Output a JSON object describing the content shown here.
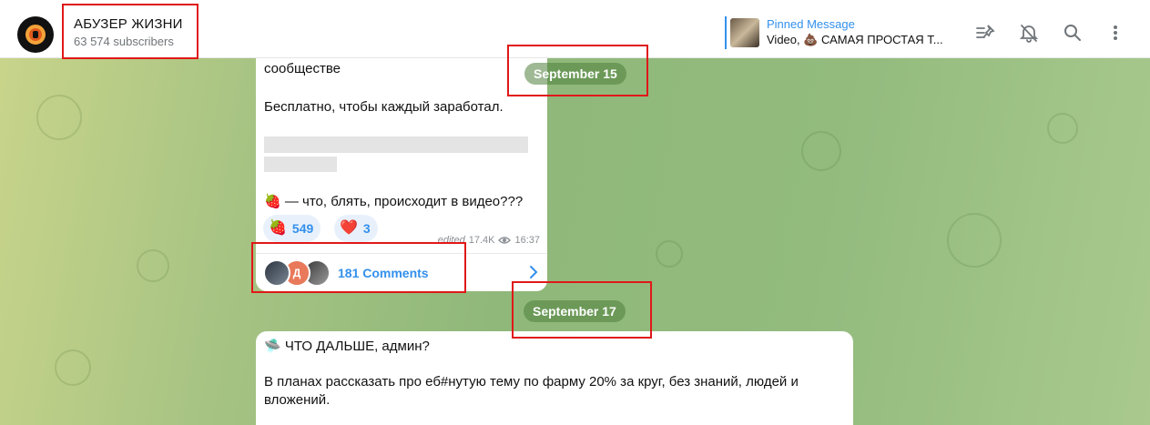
{
  "header": {
    "channel_title": "АБУЗЕР ЖИЗНИ",
    "subscribers": "63 574 subscribers",
    "pinned": {
      "label": "Pinned Message",
      "preview": "Video, 💩 САМАЯ ПРОСТАЯ Т..."
    },
    "icons": [
      "pinned-list-icon",
      "mute-bell-icon",
      "search-icon",
      "more-vertical-icon"
    ]
  },
  "messages": [
    {
      "lines": [
        "сообществе",
        "Бесплатно, чтобы каждый заработал.",
        "🍓 — что, блять, происходит в видео???"
      ],
      "reactions": [
        {
          "emoji": "🍓",
          "count": "549"
        },
        {
          "emoji": "❤️",
          "count": "3"
        }
      ],
      "edited": "edited",
      "views": "17.4K",
      "time": "16:37",
      "comments_label": "181 Comments",
      "commenter_avatar_letter": "Д"
    },
    {
      "title": "🛸 ЧТО ДАЛЬШЕ, админ?",
      "body": "В планах рассказать про еб#нутую тему по фарму 20% за круг, без знаний, людей и вложений."
    }
  ],
  "dates": [
    "September 15",
    "September 17"
  ],
  "colors": {
    "accent": "#3390ec",
    "annotation": "#e01818",
    "date_pill": "#6f9a5a"
  }
}
